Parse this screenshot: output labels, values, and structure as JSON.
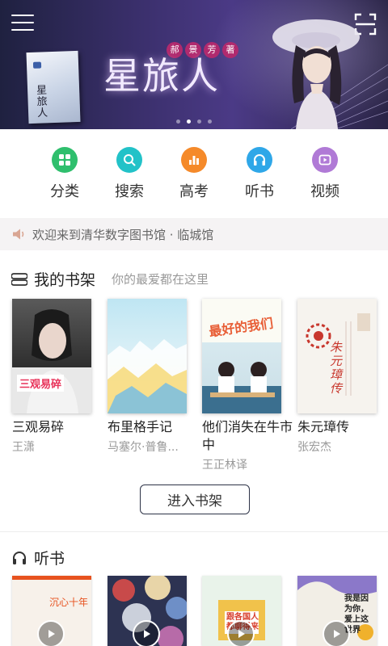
{
  "banner": {
    "title": "星旅人",
    "author_marks": [
      "郝",
      "景",
      "芳",
      "著"
    ],
    "cover_text": "星旅人",
    "slides_total": 4,
    "slide_active": 1
  },
  "categories": [
    {
      "label": "分类",
      "icon": "grid-icon",
      "color": "#2fbf6d"
    },
    {
      "label": "搜索",
      "icon": "search-icon",
      "color": "#22c2c8"
    },
    {
      "label": "高考",
      "icon": "bar-chart-icon",
      "color": "#f58a2a"
    },
    {
      "label": "听书",
      "icon": "headphones-icon",
      "color": "#2fa7e8"
    },
    {
      "label": "视频",
      "icon": "video-icon",
      "color": "#b07ad6"
    }
  ],
  "notice": {
    "text": "欢迎来到清华数字图书馆 · 临城馆"
  },
  "shelf": {
    "title": "我的书架",
    "subtitle": "你的最爱都在这里",
    "books": [
      {
        "title": "三观易碎",
        "author": "王潇",
        "cover_text": "三观易碎"
      },
      {
        "title": "布里格手记",
        "author": "马塞尔·普鲁..."
      },
      {
        "title": "他们消失在牛市中",
        "author": "王正林译",
        "cover_text": "最好的我们"
      },
      {
        "title": "朱元璋传",
        "author": "张宏杰",
        "cover_text": "朱元璋传"
      }
    ],
    "enter_button": "进入书架"
  },
  "audio": {
    "title": "听书",
    "covers": [
      {
        "cover_text": "沉心十年"
      },
      {
        "cover_text": ""
      },
      {
        "cover_text": "跟各国人都聊得来"
      },
      {
        "cover_text": "我是因为你，爱上这世界"
      }
    ]
  }
}
